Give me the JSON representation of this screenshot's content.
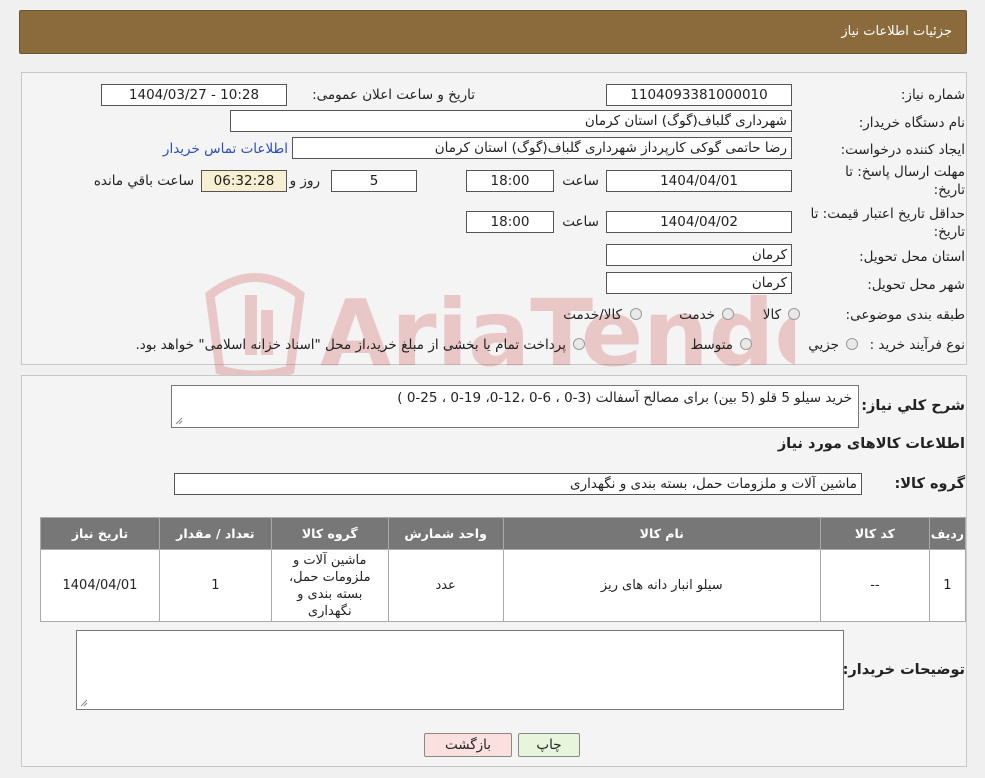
{
  "header": {
    "title": "جزئیات اطلاعات نیاز"
  },
  "fields": {
    "need_number_label": "شماره نیاز:",
    "need_number": "1104093381000010",
    "announce_label": "تاریخ و ساعت اعلان عمومی:",
    "announce_value": "1404/03/27 - 10:28",
    "buyer_org_label": "نام دستگاه خریدار:",
    "buyer_org": "شهرداری گلباف(گوگ) استان کرمان",
    "creator_label": "ایجاد کننده درخواست:",
    "creator": "رضا حاتمی گوکی کارپرداز شهرداری گلباف(گوگ) استان کرمان",
    "contact_link": "اطلاعات تماس خریدار",
    "deadline_label_line1": "مهلت ارسال پاسخ: تا",
    "deadline_label_line2": "تاریخ:",
    "deadline_date": "1404/04/01",
    "time_label": "ساعت",
    "deadline_time": "18:00",
    "days_value": "5",
    "days_label": "روز و",
    "remaining_time": "06:32:28",
    "remaining_label": "ساعت باقي مانده",
    "min_validity_label_line1": "حداقل تاریخ اعتبار قیمت: تا",
    "min_validity_label_line2": "تاریخ:",
    "min_validity_date": "1404/04/02",
    "min_validity_time": "18:00",
    "province_label": "استان محل تحویل:",
    "province": "کرمان",
    "city_label": "شهر محل تحویل:",
    "city": "کرمان",
    "category_label": "طبقه بندی موضوعی:",
    "category_options": [
      "کالا",
      "خدمت",
      "کالا/خدمت"
    ],
    "process_label": "نوع فرآیند خرید :",
    "process_options": [
      "جزیي",
      "متوسط"
    ],
    "process_note": "پرداخت تمام یا بخشی از مبلغ خرید،از محل \"اسناد خزانه اسلامی\" خواهد بود."
  },
  "description": {
    "label": "شرح کلي نیاز:",
    "value": "خرید سیلو 5 قلو (5 بین) برای مصالح آسفالت (3-0 ، 6-0 ،12-0، 19-0 ، 25-0 )"
  },
  "goods_section_title": "اطلاعات کالاهای مورد نیاز",
  "goods_group": {
    "label": "گروه کالا:",
    "value": "ماشین آلات و ملزومات حمل، بسته بندی و نگهداری"
  },
  "table": {
    "headers": [
      "ردیف",
      "کد کالا",
      "نام کالا",
      "واحد شمارش",
      "گروه کالا",
      "تعداد / مقدار",
      "تاریخ نیاز"
    ],
    "rows": [
      [
        "1",
        "--",
        "سیلو انبار دانه های ریز",
        "عدد",
        "ماشین آلات و ملزومات حمل، بسته بندی و نگهداری",
        "1",
        "1404/04/01"
      ]
    ]
  },
  "buyer_notes": {
    "label": "توضیحات خریدار:",
    "value": ""
  },
  "buttons": {
    "print": "چاپ",
    "back": "بازگشت"
  },
  "watermark_text": "AriaTender.neT",
  "colors": {
    "header": "#8b6a3c",
    "table_header": "#777777",
    "print_button": "#e6f5dc",
    "back_button": "#fbe0e0",
    "link": "#2a4fb8"
  }
}
